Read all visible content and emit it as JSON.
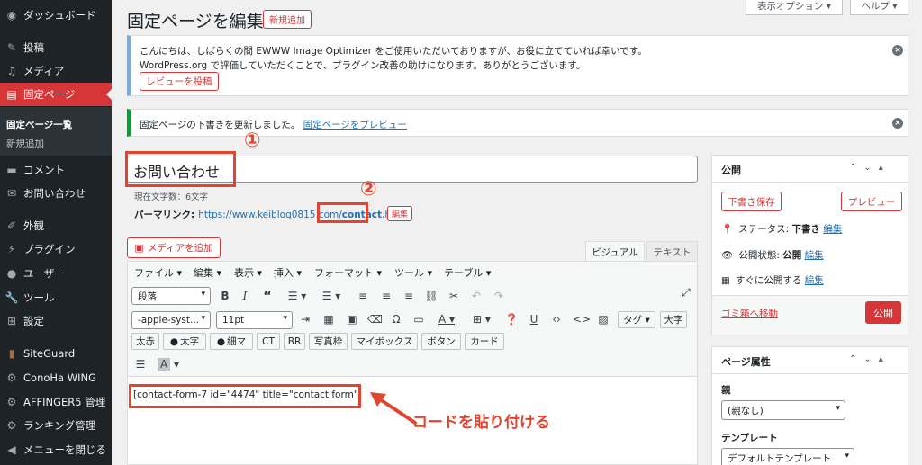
{
  "sidebar": {
    "items": [
      {
        "label": "ダッシュボード",
        "icon": "dashboard-icon",
        "glyph": "◉"
      },
      {
        "label": "投稿",
        "icon": "pin-icon",
        "glyph": "✎"
      },
      {
        "label": "メディア",
        "icon": "media-icon",
        "glyph": "♫"
      },
      {
        "label": "固定ページ",
        "icon": "pages-icon",
        "glyph": "▤"
      },
      {
        "label": "固定ページ一覧"
      },
      {
        "label": "新規追加"
      },
      {
        "label": "コメント",
        "icon": "comment-icon",
        "glyph": "▬"
      },
      {
        "label": "お問い合わせ",
        "icon": "mail-icon",
        "glyph": "✉"
      },
      {
        "label": "外観",
        "icon": "appearance-icon",
        "glyph": "✐"
      },
      {
        "label": "プラグイン",
        "icon": "plugin-icon",
        "glyph": "⚡"
      },
      {
        "label": "ユーザー",
        "icon": "user-icon",
        "glyph": "●"
      },
      {
        "label": "ツール",
        "icon": "tool-icon",
        "glyph": "🔧"
      },
      {
        "label": "設定",
        "icon": "settings-icon",
        "glyph": "⊞"
      },
      {
        "label": "SiteGuard",
        "icon": "siteguard-icon",
        "glyph": "▮"
      },
      {
        "label": "ConoHa WING",
        "icon": "gear-icon",
        "glyph": "⚙"
      },
      {
        "label": "AFFINGER5 管理",
        "icon": "gear-icon",
        "glyph": "⚙"
      },
      {
        "label": "ランキング管理",
        "icon": "gear-icon",
        "glyph": "⚙"
      },
      {
        "label": "メニューを閉じる",
        "icon": "collapse-icon",
        "glyph": "◀"
      }
    ]
  },
  "header": {
    "title": "固定ページを編集",
    "add_new": "新規追加",
    "screen_options": "表示オプション ▾",
    "help": "ヘルプ ▾"
  },
  "notice1": {
    "line1": "こんにちは、しばらくの間 EWWW Image Optimizer をご使用いただいておりますが、お役に立てていれば幸いです。",
    "line2": "WordPress.org で評価していただくことで、プラグイン改善の助けになります。ありがとうございます。",
    "button": "レビューを投稿"
  },
  "notice2": {
    "text": "固定ページの下書きを更新しました。",
    "link": "固定ページをプレビュー"
  },
  "editor": {
    "title_value": "お問い合わせ",
    "char_count": "現在文字数：6文字",
    "permalink_label": "パーマリンク:",
    "permalink_base": "https://www.keiblog0815.com/",
    "permalink_slug": "contact",
    "permalink_end": ".html",
    "permalink_edit": "編集",
    "add_media": "メディアを追加",
    "tab_visual": "ビジュアル",
    "tab_text": "テキスト",
    "menubar": [
      "ファイル ▾",
      "編集 ▾",
      "表示 ▾",
      "挿入 ▾",
      "フォーマット ▾",
      "ツール ▾",
      "テーブル ▾"
    ],
    "format_select": "段落",
    "font_select": "-apple-syst...",
    "size_select": "11pt",
    "tag_select": "タグ ▾",
    "daiji": "大字",
    "row3": [
      "太赤",
      "太字",
      "細マ",
      "CT",
      "BR",
      "写真枠",
      "マイボックス",
      "ボタン",
      "カード"
    ],
    "content": "[contact-form-7 id=\"4474\" title=\"contact form\"]"
  },
  "annotations": {
    "num1": "①",
    "num2": "②",
    "arrow_text": "コードを貼り付ける",
    "color": "#e2452f"
  },
  "publish": {
    "title": "公開",
    "save_draft": "下書き保存",
    "preview": "プレビュー",
    "status_label": "ステータス:",
    "status_value": "下書き",
    "visibility_label": "公開状態:",
    "visibility_value": "公開",
    "schedule": "すぐに公開する",
    "edit": "編集",
    "trash": "ゴミ箱へ移動",
    "publish_button": "公開"
  },
  "page_attributes": {
    "title": "ページ属性",
    "parent_label": "親",
    "parent_value": "(親なし)",
    "template_label": "テンプレート",
    "template_value": "デフォルトテンプレート"
  },
  "colors": {
    "accent": "#d63638",
    "sidebar": "#1d2327",
    "link": "#2271b1"
  }
}
